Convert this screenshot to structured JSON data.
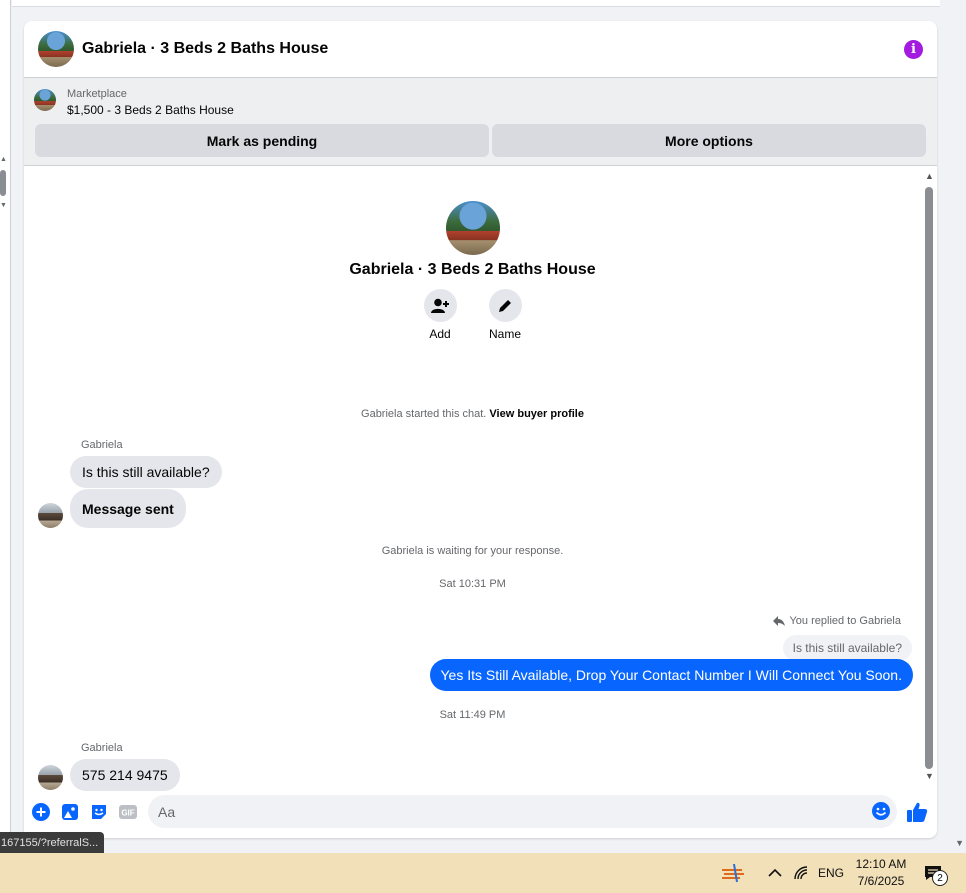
{
  "header": {
    "title": "Gabriela · 3 Beds 2 Baths House",
    "info_icon": "info-icon"
  },
  "marketplace": {
    "label": "Marketplace",
    "listing": "$1,500 - 3 Beds 2 Baths House",
    "mark_pending_label": "Mark as pending",
    "more_options_label": "More options"
  },
  "profile": {
    "name": "Gabriela · 3 Beds 2 Baths House",
    "add_label": "Add",
    "name_label": "Name"
  },
  "thread": {
    "started_text": "Gabriela started this chat.",
    "view_profile_label": "View buyer profile",
    "sender1": "Gabriela",
    "msg1": "Is this still available?",
    "msg2": "Message sent",
    "waiting_text": "Gabriela is waiting for your response.",
    "time1": "Sat 10:31 PM",
    "reply_note": "You replied to Gabriela",
    "quoted_text": "Is this still available?",
    "reply_text": "Yes Its Still Available, Drop Your Contact Number I Will Connect You Soon.",
    "time2": "Sat 11:49 PM",
    "sender2": "Gabriela",
    "msg3": "575 214 9475"
  },
  "composer": {
    "placeholder": "Aa"
  },
  "status_bar": {
    "url": "167155/?referralS..."
  },
  "taskbar": {
    "language": "ENG",
    "time": "12:10 AM",
    "date": "7/6/2025",
    "notification_count": "2"
  },
  "colors": {
    "accent": "#0866ff",
    "info": "#a21bde",
    "taskbar": "#f1e0b8"
  }
}
